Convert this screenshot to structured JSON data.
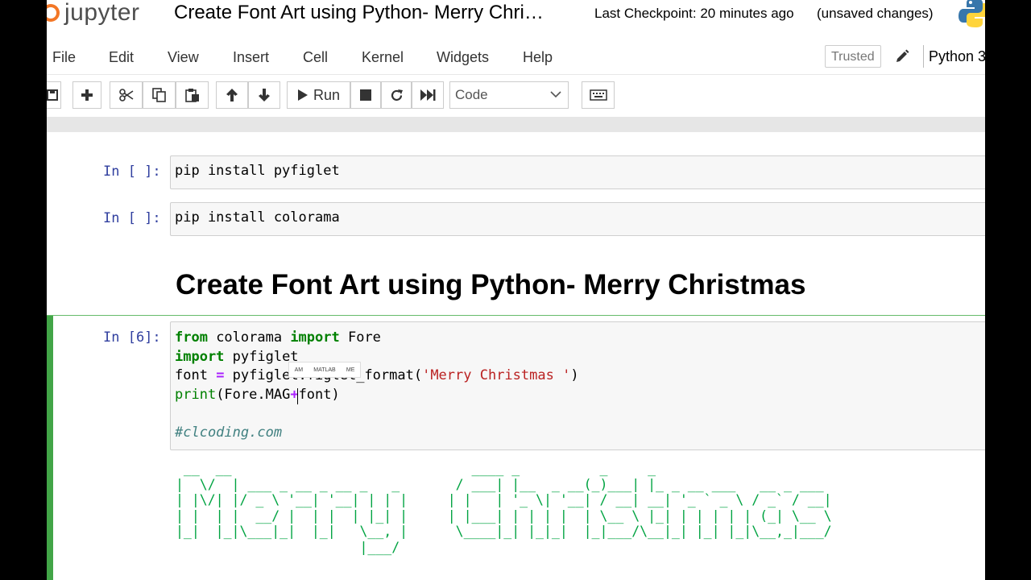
{
  "header": {
    "logo_text": "jupyter",
    "notebook_title": "Create Font Art using Python- Merry Chri…",
    "checkpoint": "Last Checkpoint: 20 minutes ago",
    "unsaved": "(unsaved changes)"
  },
  "menubar": {
    "items": [
      "File",
      "Edit",
      "View",
      "Insert",
      "Cell",
      "Kernel",
      "Widgets",
      "Help"
    ],
    "trusted": "Trusted",
    "kernel": "Python 3"
  },
  "toolbar": {
    "run_label": "Run",
    "cell_type": "Code",
    "icons": [
      "save-icon",
      "plus-icon",
      "scissors-icon",
      "copy-icon",
      "paste-icon",
      "arrow-up-icon",
      "arrow-down-icon",
      "play-icon",
      "stop-icon",
      "restart-icon",
      "fast-forward-icon",
      "chevron-down-icon",
      "keyboard-icon"
    ]
  },
  "cells": [
    {
      "prompt": "In [ ]:",
      "code": "pip install pyfiglet"
    },
    {
      "prompt": "In [ ]:",
      "code": "pip install colorama"
    }
  ],
  "markdown": {
    "heading": "Create Font Art using Python- Merry Christmas"
  },
  "active_cell": {
    "prompt": "In [6]:",
    "line1": {
      "kw1": "from",
      "mid": " colorama ",
      "kw2": "import",
      "rest": " Fore"
    },
    "line2": {
      "kw": "import",
      "rest": " pyfiglet"
    },
    "line3": {
      "pre": "font ",
      "op": "=",
      "mid": " pyfiglet.figlet_format(",
      "str": "'Merry Christmas '",
      "post": ")"
    },
    "line4": {
      "fn": "print",
      "pre": "(Fore.MAG",
      "op": "+",
      "post": "font)"
    },
    "comment": "#clcoding.com"
  },
  "autocomplete": [
    "AM",
    "MATLAB",
    "ME"
  ],
  "output": {
    "ascii": " __  __                              ____ _          _     _                       \n|  \\/  | ___ _ __ _ __ _   _       / ___| |__  _ __(_)___| |_ _ __ ___   __ _ ___ \n| |\\/| |/ _ \\ '__| '__| | | |     | |   | '_ \\| '__| / __| __| '_ ` _ \\ / _` / __|\n| |  | |  __/ |  | |  | |_| |     | |___| | | | |  | \\__ \\ |_| | | | | | (_| \\__ \\\n|_|  |_|\\___|_|  |_|   \\__, |      \\____|_| |_|_|  |_|___/\\__|_| |_| |_|\\__,_|___/\n                       |___/                                                      "
  },
  "colors": {
    "selected_cell": "#42a547",
    "prompt": "#303f9f",
    "ascii": "#00a341"
  }
}
